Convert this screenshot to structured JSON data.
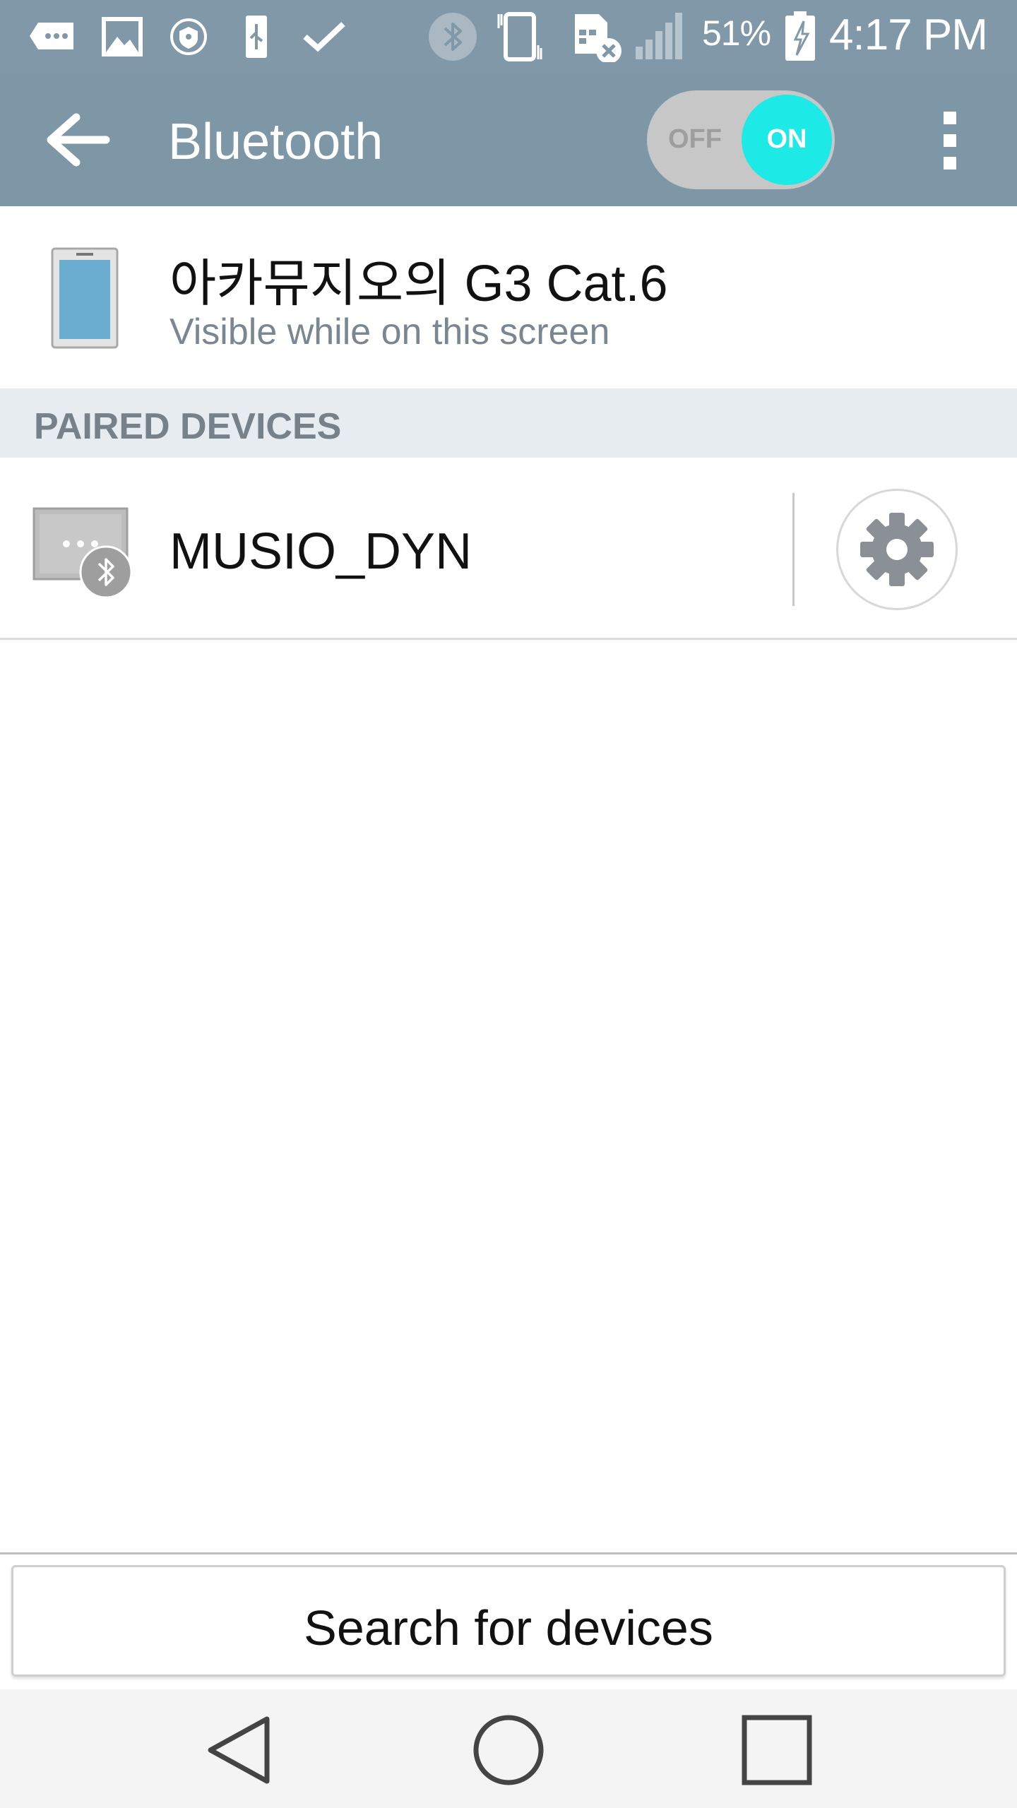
{
  "status_bar": {
    "battery_percent": "51%",
    "time": "4:17 PM",
    "icons": [
      "message-icon",
      "image-icon",
      "shield-icon",
      "usb-icon",
      "check-icon",
      "bluetooth-icon",
      "vibrate-icon",
      "sim-error-icon",
      "signal-icon",
      "battery-charging-icon"
    ]
  },
  "app_bar": {
    "title": "Bluetooth",
    "toggle": {
      "off_label": "OFF",
      "on_label": "ON",
      "state": "on"
    }
  },
  "this_device": {
    "name": "아카뮤지오의 G3 Cat.6",
    "subtitle": "Visible while on this screen"
  },
  "paired_section": {
    "header": "PAIRED DEVICES",
    "devices": [
      {
        "name": "MUSIO_DYN"
      }
    ]
  },
  "search_button": {
    "label": "Search for devices"
  },
  "nav_bar": {
    "buttons": [
      "back-nav-icon",
      "home-nav-icon",
      "recents-nav-icon"
    ]
  },
  "colors": {
    "header_bg": "#7e97a6",
    "toggle_accent": "#1de9e6",
    "section_bg": "#e6ecef"
  }
}
